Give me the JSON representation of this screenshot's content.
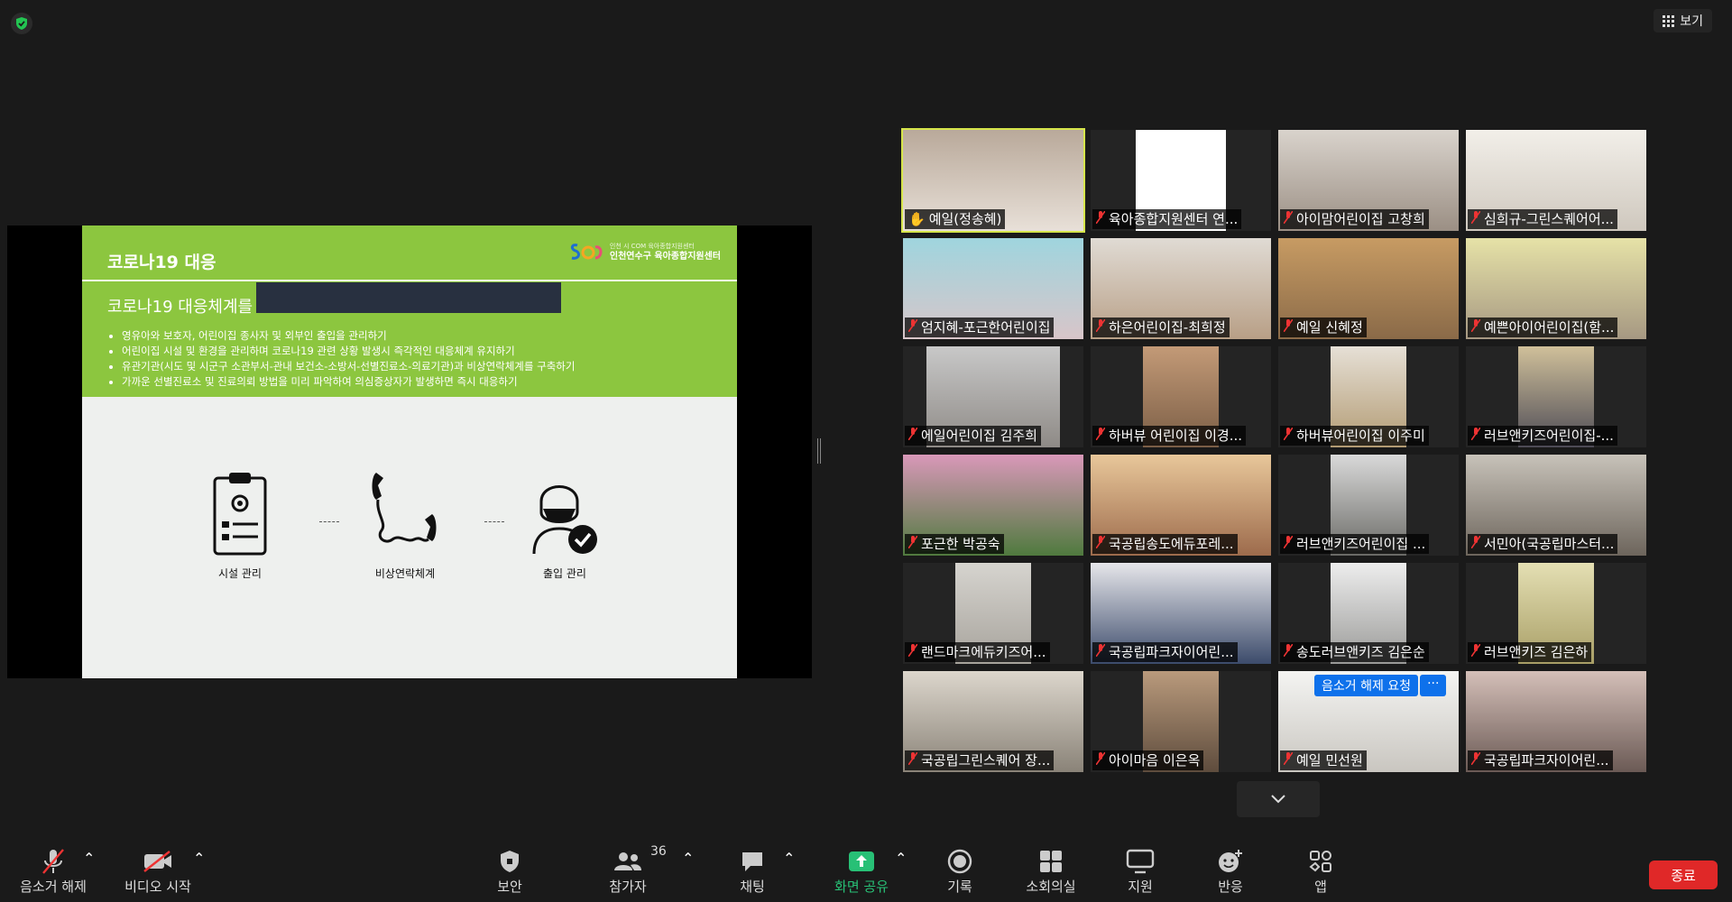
{
  "topbar": {
    "view_label": "보기"
  },
  "slide": {
    "title": "코로나19 대응",
    "org_small": "인천 시 COM 육아종합지원센터",
    "org_name": "인천연수구 육아종합지원센터",
    "subtitle": "코로나19 대응체계를",
    "bullets": [
      "영유아와 보호자, 어린이집 종사자 및 외부인 출입을 관리하기",
      "어린이집 시설 및 환경을 관리하며 코로나19 관련 상황 발생시 즉각적인 대응체계 유지하기",
      "유관기관(시도 및 시군구 소관부서-관내 보건소-소방서-선별진료소-의료기관)과 비상연락체계를 구축하기",
      "가까운 선별진료소 및 진료의뢰 방법을 미리 파악하여 의심증상자가 발생하면 즉시 대응하기"
    ],
    "icons": [
      {
        "label": "시설 관리",
        "icon": "clipboard-gear-icon"
      },
      {
        "label": "비상연락체계",
        "icon": "phone-icon"
      },
      {
        "label": "출입 관리",
        "icon": "masked-person-check-icon"
      }
    ]
  },
  "participants": [
    {
      "name": "예일(정송혜)",
      "muted": false,
      "active": true
    },
    {
      "name": "육아종합지원센터 연...",
      "muted": true
    },
    {
      "name": "아이맘어린이집 고창희",
      "muted": true
    },
    {
      "name": "심희규-그린스퀘어어...",
      "muted": true
    },
    {
      "name": "엄지혜-포근한어린이집",
      "muted": true
    },
    {
      "name": "하은어린이집-최희정",
      "muted": true
    },
    {
      "name": "예일 신혜정",
      "muted": true
    },
    {
      "name": "예쁜아이어린이집(함...",
      "muted": true
    },
    {
      "name": "에일어린이집 김주희",
      "muted": true
    },
    {
      "name": "하버뷰 어린이집 이경...",
      "muted": true
    },
    {
      "name": "하버뷰어린이집 이주미",
      "muted": true
    },
    {
      "name": "러브앤키즈어린이집-...",
      "muted": true
    },
    {
      "name": "포근한 박공숙",
      "muted": true
    },
    {
      "name": "국공립송도에듀포레...",
      "muted": true
    },
    {
      "name": "러브앤키즈어린이집 ...",
      "muted": true
    },
    {
      "name": "서민아(국공립마스터...",
      "muted": true
    },
    {
      "name": "랜드마크에듀키즈어...",
      "muted": true
    },
    {
      "name": "국공립파크자이어린...",
      "muted": true
    },
    {
      "name": "송도러브앤키즈 김은순",
      "muted": true
    },
    {
      "name": "러브앤키즈 김은하",
      "muted": true
    },
    {
      "name": "국공립그린스퀘어 장...",
      "muted": true
    },
    {
      "name": "아이마음 이은옥",
      "muted": true
    },
    {
      "name": "예일 민선원",
      "muted": true
    },
    {
      "name": "국공립파크자이어린...",
      "muted": true
    }
  ],
  "unmute_request": {
    "label": "음소거 해제 요청",
    "more": "···"
  },
  "toolbar": {
    "unmute": "음소거 해제",
    "video": "비디오 시작",
    "security": "보안",
    "participants": "참가자",
    "participants_count": "36",
    "chat": "채팅",
    "share": "화면 공유",
    "record": "기록",
    "breakout": "소회의실",
    "support": "지원",
    "reactions": "반응",
    "apps": "앱",
    "end": "종료"
  },
  "colors": {
    "share_green": "#28c076",
    "end_red": "#e02828",
    "active_border": "#d6e54b",
    "slide_green": "#8cc63f"
  }
}
